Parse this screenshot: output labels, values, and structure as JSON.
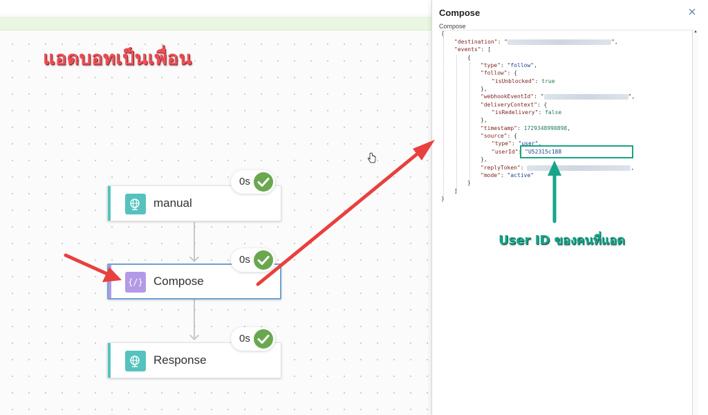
{
  "canvas": {
    "annotation_title": "แอดบอทเป็นเพื่อน",
    "uid_callout": "User ID ของคนที่แอด"
  },
  "flow": {
    "nodes": [
      {
        "label": "manual",
        "duration": "0s",
        "status": "succeeded",
        "icon": "globe-request-icon",
        "accent": "#56c2bd"
      },
      {
        "label": "Compose",
        "duration": "0s",
        "status": "succeeded",
        "icon": "compose-braces-icon",
        "accent": "#b39ae6"
      },
      {
        "label": "Response",
        "duration": "0s",
        "status": "succeeded",
        "icon": "globe-response-icon",
        "accent": "#56c2bd"
      }
    ]
  },
  "panel": {
    "title": "Compose",
    "subtitle": "Compose",
    "json": {
      "open_brace": "{",
      "destination_key": "\"destination\"",
      "events_key": "\"events\"",
      "type_key": "\"type\"",
      "type_val": "\"follow\"",
      "follow_key": "\"follow\"",
      "isUnblocked_key": "\"isUnblocked\"",
      "isUnblocked_val": "true",
      "webhookEventId_key": "\"webhookEventId\"",
      "deliveryContext_key": "\"deliveryContext\"",
      "isRedelivery_key": "\"isRedelivery\"",
      "isRedelivery_val": "false",
      "timestamp_key": "\"timestamp\"",
      "timestamp_val": "1729348990898",
      "source_key": "\"source\"",
      "source_type_val": "\"user\"",
      "userId_key": "\"userId\"",
      "userId_val": "\"U52315c188",
      "replyToken_key": "\"replyToken\"",
      "mode_key": "\"mode\"",
      "mode_val": "\"active\"",
      "close_brace": "}"
    }
  },
  "colors": {
    "annotation_red": "#ef5058",
    "callout_teal": "#17a589",
    "success_green": "#6aa84f",
    "selection_blue": "#6ea2d6"
  }
}
